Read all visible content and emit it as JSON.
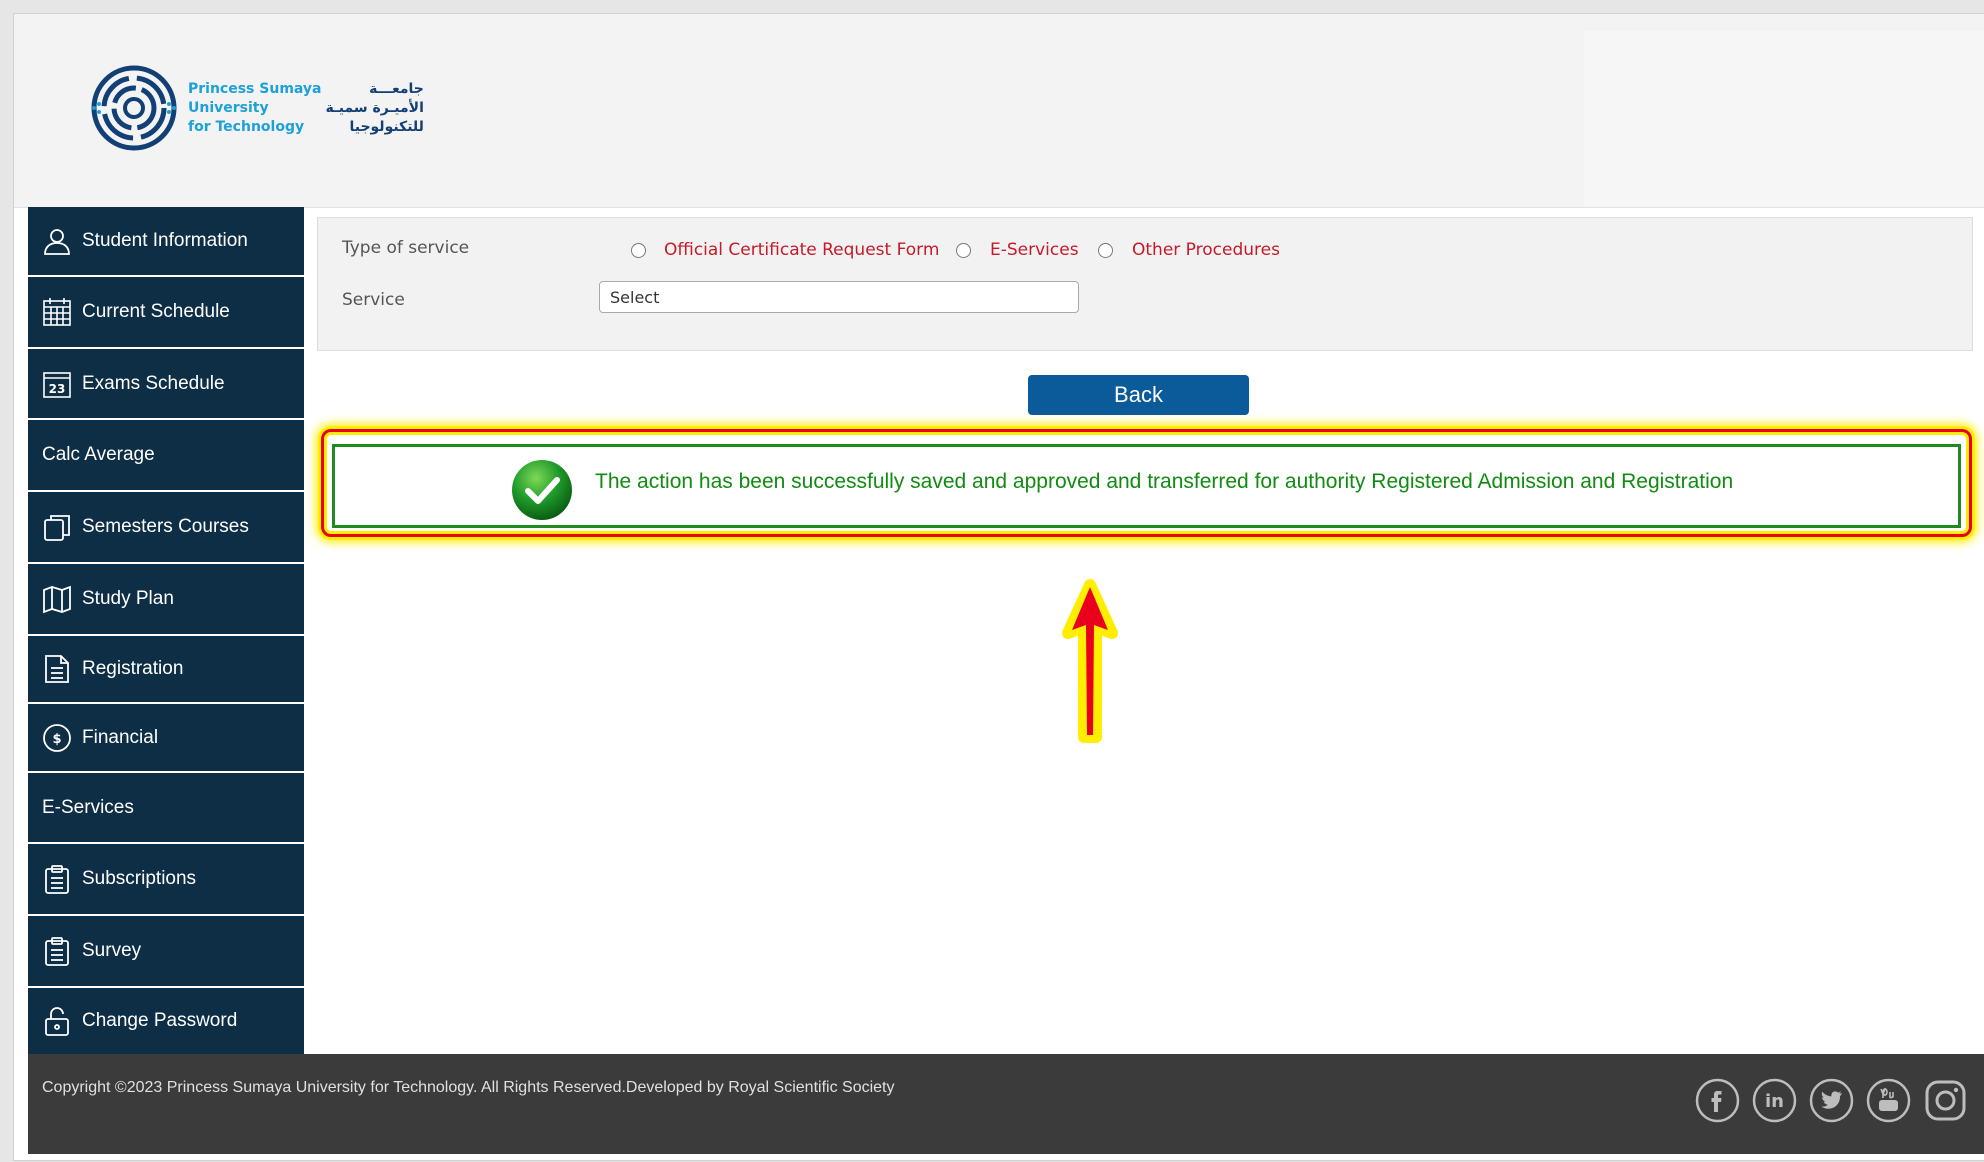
{
  "header": {
    "logo": {
      "en_lines": [
        "Princess Sumaya",
        "University",
        "for Technology"
      ],
      "ar_lines": [
        "جامعـــة",
        "الأميـرة سميـة",
        "للتكنولوجيا"
      ]
    }
  },
  "sidebar": {
    "items": [
      {
        "label": "Student Information",
        "icon": "user-icon"
      },
      {
        "label": "Current Schedule",
        "icon": "calendar-icon"
      },
      {
        "label": "Exams Schedule",
        "icon": "calendar-23-icon"
      },
      {
        "label": "Calc Average",
        "icon": ""
      },
      {
        "label": "Semesters Courses",
        "icon": "copy-icon"
      },
      {
        "label": "Study Plan",
        "icon": "map-icon"
      },
      {
        "label": "Registration",
        "icon": "document-icon"
      },
      {
        "label": "Financial",
        "icon": "dollar-icon"
      },
      {
        "label": "E-Services",
        "icon": ""
      },
      {
        "label": "Subscriptions",
        "icon": "clipboard-icon"
      },
      {
        "label": "Survey",
        "icon": "clipboard-icon"
      },
      {
        "label": "Change Password",
        "icon": "unlock-icon"
      }
    ]
  },
  "form": {
    "type_label": "Type of service",
    "service_label": "Service",
    "options": [
      "Official Certificate Request Form",
      "E-Services",
      "Other Procedures"
    ],
    "service_value": "Select"
  },
  "back_label": "Back",
  "message": {
    "text": "The action has been successfully saved and approved and transferred for authority Registered Admission and Registration"
  },
  "footer": {
    "copyright": "Copyright ©2023 Princess Sumaya University for Technology. All Rights Reserved.Developed by Royal Scientific Society",
    "social": [
      "facebook-icon",
      "linkedin-icon",
      "twitter-icon",
      "youtube-icon",
      "instagram-icon"
    ]
  },
  "colors": {
    "sidebar_bg": "#0d2e45",
    "accent_blue": "#0b5a9a",
    "option_red": "#c51a2a",
    "success_green": "#118c11",
    "footer_bg": "#3b3b3b",
    "highlight_red": "#e8001c",
    "highlight_yellow": "#ffee00"
  }
}
